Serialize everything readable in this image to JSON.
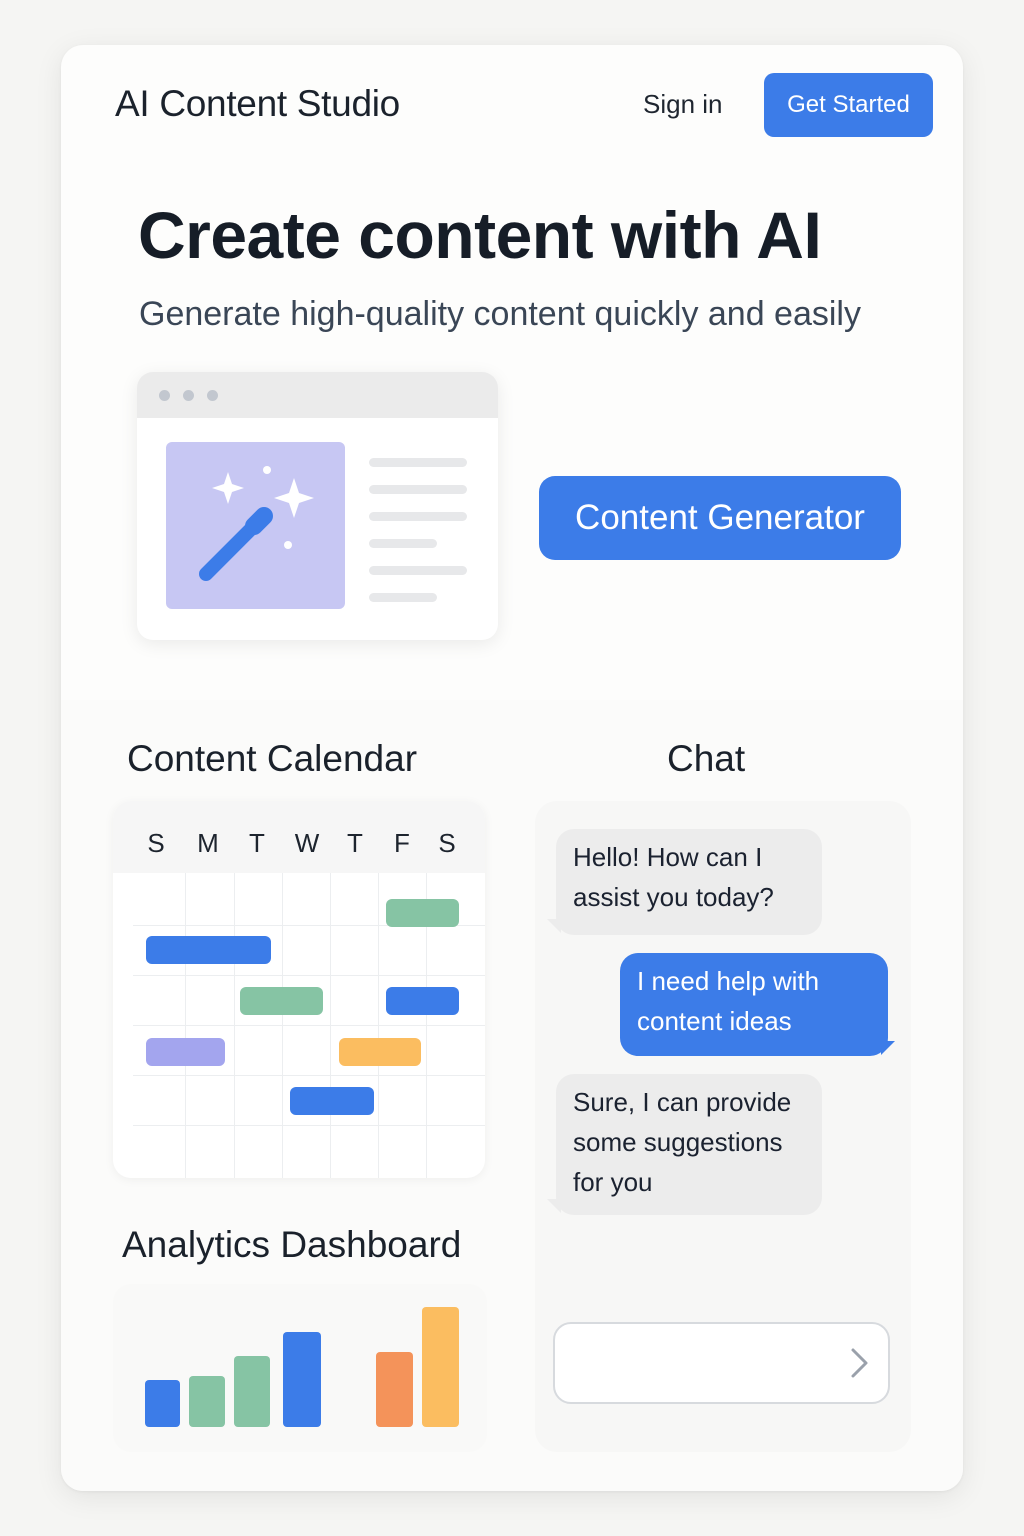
{
  "header": {
    "brand": "AI Content Studio",
    "signin_label": "Sign in",
    "get_started_label": "Get Started"
  },
  "hero": {
    "title": "Create content with AI",
    "subtitle": "Generate high-quality content quickly and easily",
    "illustration_icon": "magic-wand-icon",
    "cta_label": "Content Generator"
  },
  "calendar": {
    "title": "Content Calendar",
    "days": [
      "S",
      "M",
      "T",
      "W",
      "T",
      "F",
      "S"
    ]
  },
  "analytics": {
    "title": "Analytics Dashboard"
  },
  "chat": {
    "title": "Chat",
    "messages": [
      {
        "from": "assistant",
        "text": "Hello! How can I\nassist you today?"
      },
      {
        "from": "user",
        "text": "I need help with\ncontent ideas"
      },
      {
        "from": "assistant",
        "text": "Sure, I can provide\nsome suggestions\nfor you"
      }
    ],
    "input_placeholder": "",
    "send_icon": "chevron-right-icon"
  },
  "colors": {
    "accent": "#3c7ce8",
    "green": "#86c4a4",
    "purple": "#a3a5ee",
    "yellow": "#fbbd60",
    "orange": "#f4935a",
    "illustration_bg": "#c7c7f3"
  }
}
